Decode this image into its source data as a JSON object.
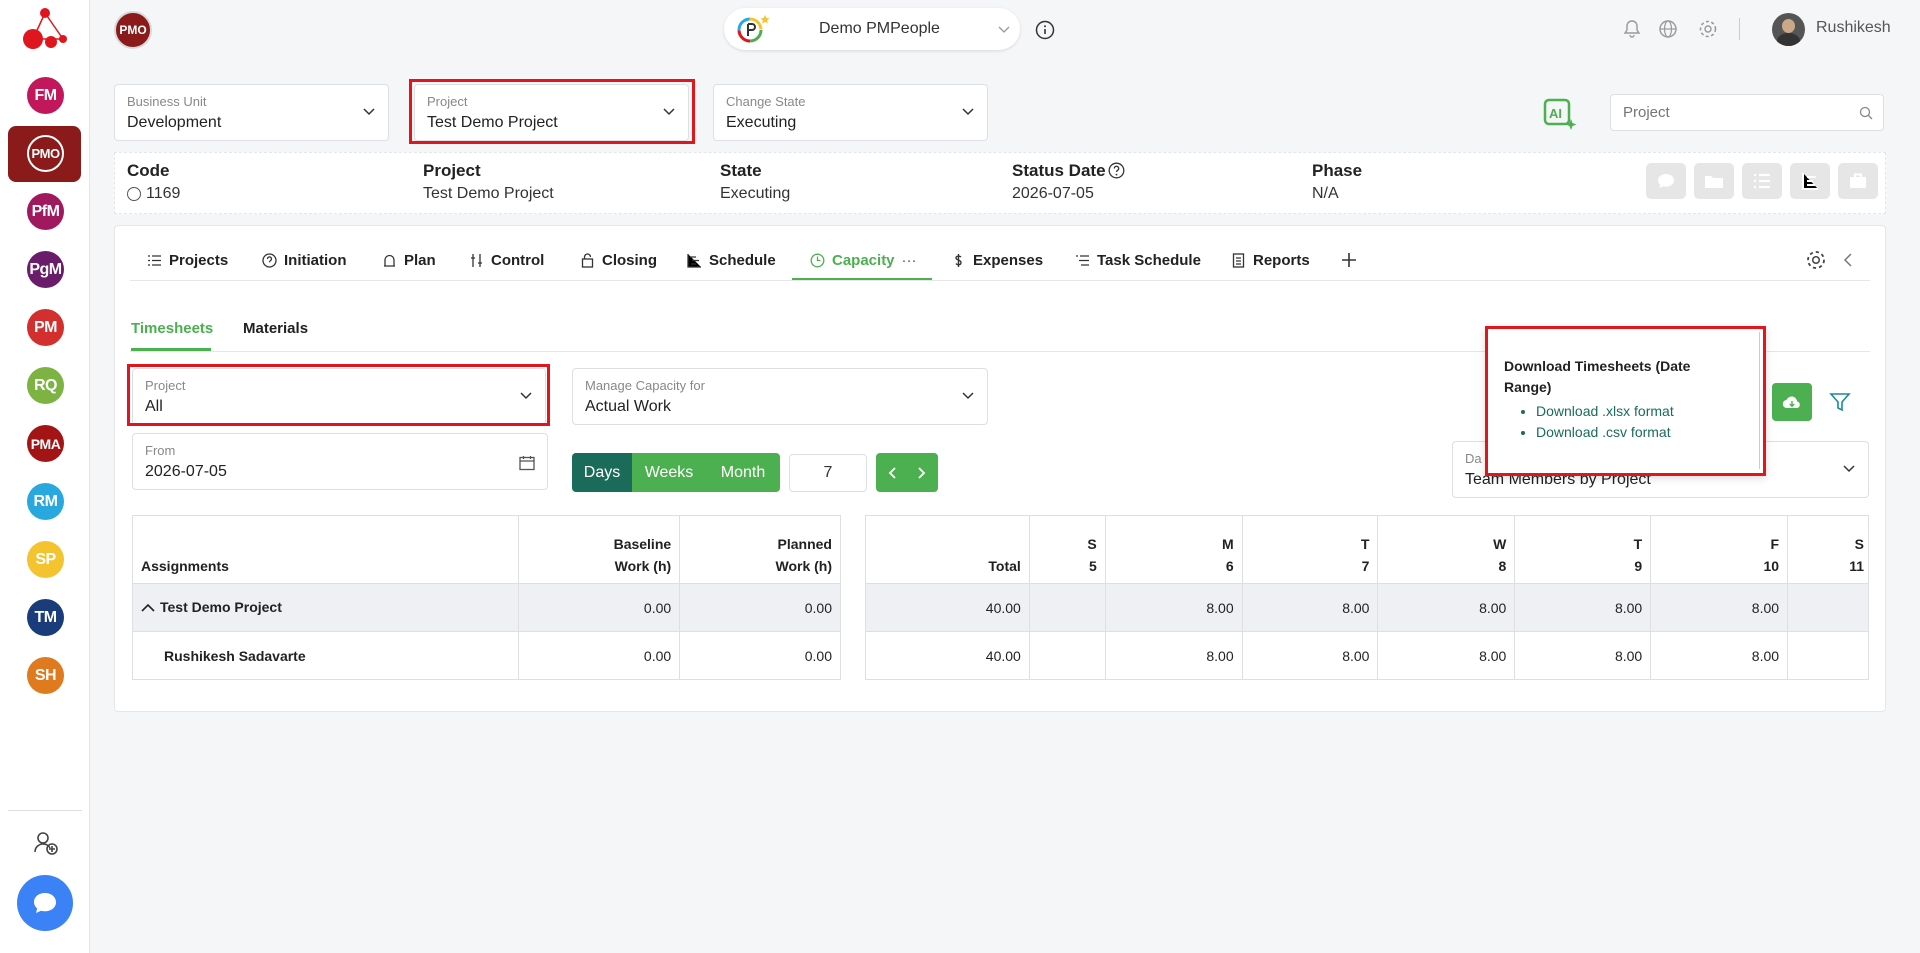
{
  "header": {
    "avatar": "PMO",
    "org_name": "Demo PMPeople",
    "user_name": "Rushikesh"
  },
  "sidebar": {
    "modules": [
      {
        "label": "FM",
        "color": "#c2185b"
      },
      {
        "label": "PMO",
        "color": "#8b1a1a"
      },
      {
        "label": "PfM",
        "color": "#a0195f"
      },
      {
        "label": "PgM",
        "color": "#6a1b6a"
      },
      {
        "label": "PM",
        "color": "#d32f2f"
      },
      {
        "label": "RQ",
        "color": "#7cb342"
      },
      {
        "label": "PMA",
        "color": "#a31515"
      },
      {
        "label": "RM",
        "color": "#29a8e0"
      },
      {
        "label": "SP",
        "color": "#f4c430"
      },
      {
        "label": "TM",
        "color": "#1a3c7a"
      },
      {
        "label": "SH",
        "color": "#e07a1f"
      }
    ]
  },
  "filters": {
    "business_unit": {
      "label": "Business Unit",
      "value": "Development"
    },
    "project": {
      "label": "Project",
      "value": "Test Demo Project"
    },
    "change_state": {
      "label": "Change State",
      "value": "Executing"
    },
    "search_placeholder": "Project"
  },
  "info": {
    "code_label": "Code",
    "code_value": "1169",
    "project_label": "Project",
    "project_value": "Test Demo Project",
    "state_label": "State",
    "state_value": "Executing",
    "status_date_label": "Status Date",
    "status_date_value": "2026-07-05",
    "phase_label": "Phase",
    "phase_value": "N/A"
  },
  "tabs": [
    "Projects",
    "Initiation",
    "Plan",
    "Control",
    "Closing",
    "Schedule",
    "Capacity",
    "Expenses",
    "Task Schedule",
    "Reports"
  ],
  "subtabs": [
    "Timesheets",
    "Materials"
  ],
  "capacity": {
    "project_filter": {
      "label": "Project",
      "value": "All"
    },
    "manage_for": {
      "label": "Manage Capacity for",
      "value": "Actual Work"
    },
    "from": {
      "label": "From",
      "value": "2026-07-05"
    },
    "period_buttons": [
      "Days",
      "Weeks",
      "Month"
    ],
    "period_count": "7",
    "data_view": {
      "label": "Da",
      "value": "Team Members by Project"
    }
  },
  "download_popup": {
    "title": "Download Timesheets (Date Range)",
    "links": [
      "Download .xlsx format",
      "Download .csv format"
    ]
  },
  "left_table": {
    "headers": [
      "Assignments",
      "Baseline",
      "Work (h)",
      "Planned",
      "Work (h)"
    ],
    "rows": [
      {
        "name": "Test Demo Project",
        "baseline": "0.00",
        "planned": "0.00"
      },
      {
        "name": "Rushikesh Sadavarte",
        "baseline": "0.00",
        "planned": "0.00"
      }
    ]
  },
  "right_table": {
    "total_header": "Total",
    "days": [
      {
        "d": "S",
        "n": "5"
      },
      {
        "d": "M",
        "n": "6"
      },
      {
        "d": "T",
        "n": "7"
      },
      {
        "d": "W",
        "n": "8"
      },
      {
        "d": "T",
        "n": "9"
      },
      {
        "d": "F",
        "n": "10"
      },
      {
        "d": "S",
        "n": "11"
      }
    ],
    "rows": [
      {
        "total": "40.00",
        "values": [
          "",
          "8.00",
          "8.00",
          "8.00",
          "8.00",
          "8.00",
          ""
        ]
      },
      {
        "total": "40.00",
        "values": [
          "",
          "8.00",
          "8.00",
          "8.00",
          "8.00",
          "8.00",
          ""
        ]
      }
    ]
  },
  "colors": {
    "brand": "#8b1a1a",
    "accent": "#4caf50",
    "accent_dark": "#1a6b5a",
    "highlight": "#e0161e"
  },
  "icons": [
    "bell-icon",
    "globe-icon",
    "gear-icon",
    "info-icon",
    "search-icon",
    "calendar-icon",
    "cloud-download-icon",
    "filter-icon",
    "chat-icon",
    "add-user-icon",
    "ai-icon"
  ]
}
